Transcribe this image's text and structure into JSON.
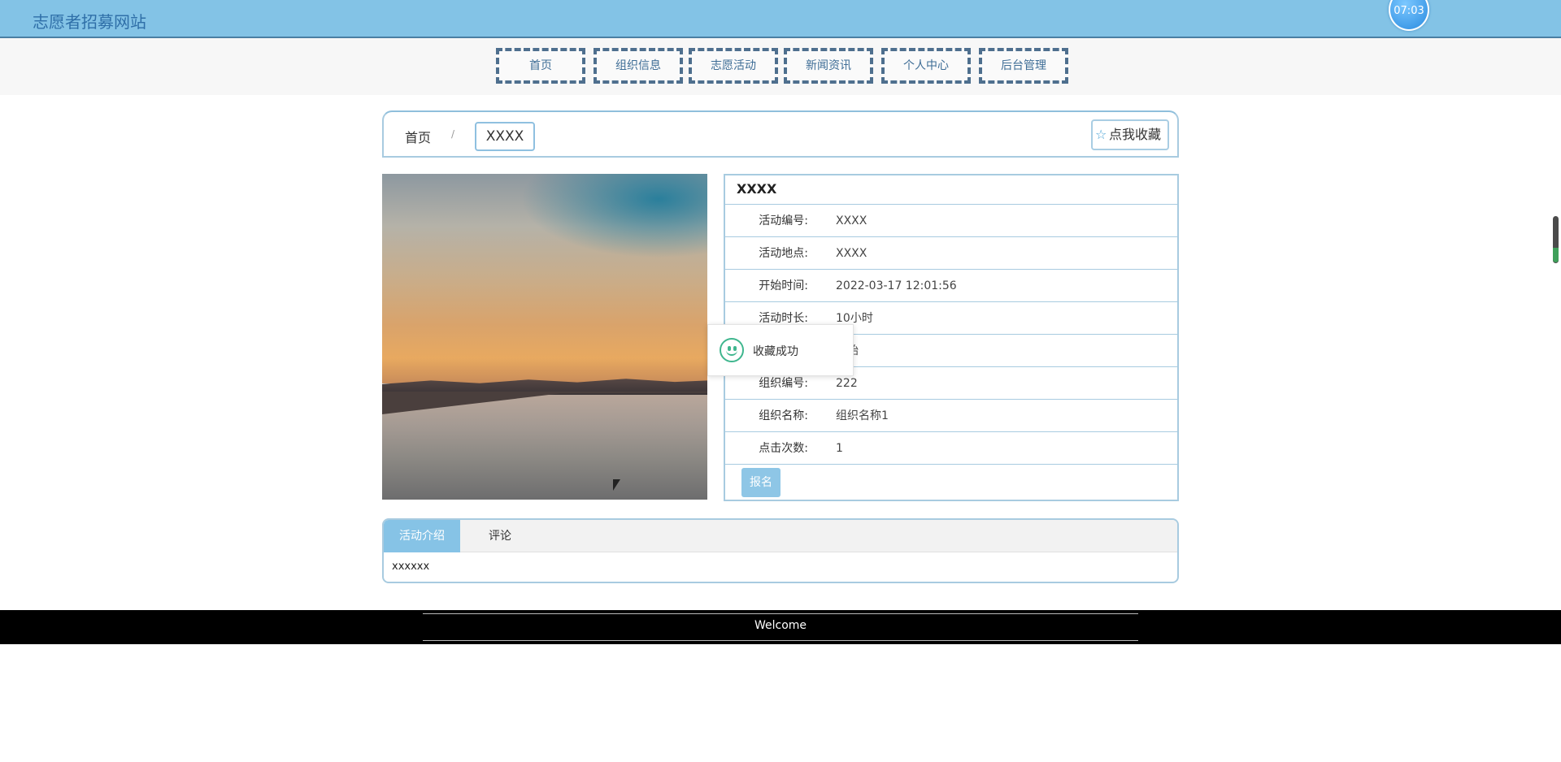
{
  "header": {
    "site_title": "志愿者招募网站",
    "clock": "07:03"
  },
  "nav": {
    "items": [
      "首页",
      "组织信息",
      "志愿活动",
      "新闻资讯",
      "个人中心",
      "后台管理"
    ]
  },
  "breadcrumb": {
    "home": "首页",
    "separator": "/",
    "current": "XXXX",
    "favorite_label": "点我收藏"
  },
  "activity": {
    "title": "XXXX",
    "fields": [
      {
        "label": "活动编号:",
        "value": "XXXX"
      },
      {
        "label": "活动地点:",
        "value": "XXXX"
      },
      {
        "label": "开始时间:",
        "value": "2022-03-17 12:01:56"
      },
      {
        "label": "活动时长:",
        "value": "10小时"
      },
      {
        "label": "",
        "value": "开始"
      },
      {
        "label": "组织编号:",
        "value": "222"
      },
      {
        "label": "组织名称:",
        "value": "组织名称1"
      },
      {
        "label": "点击次数:",
        "value": "1"
      }
    ],
    "signup_label": "报名"
  },
  "toast": {
    "message": "收藏成功"
  },
  "tabs": {
    "items": [
      "活动介绍",
      "评论"
    ],
    "content": "xxxxxx"
  },
  "footer": {
    "text": "Welcome"
  },
  "colors": {
    "accent": "#83c3e6",
    "nav_border": "#4e6f8e",
    "success": "#3fb68e"
  }
}
